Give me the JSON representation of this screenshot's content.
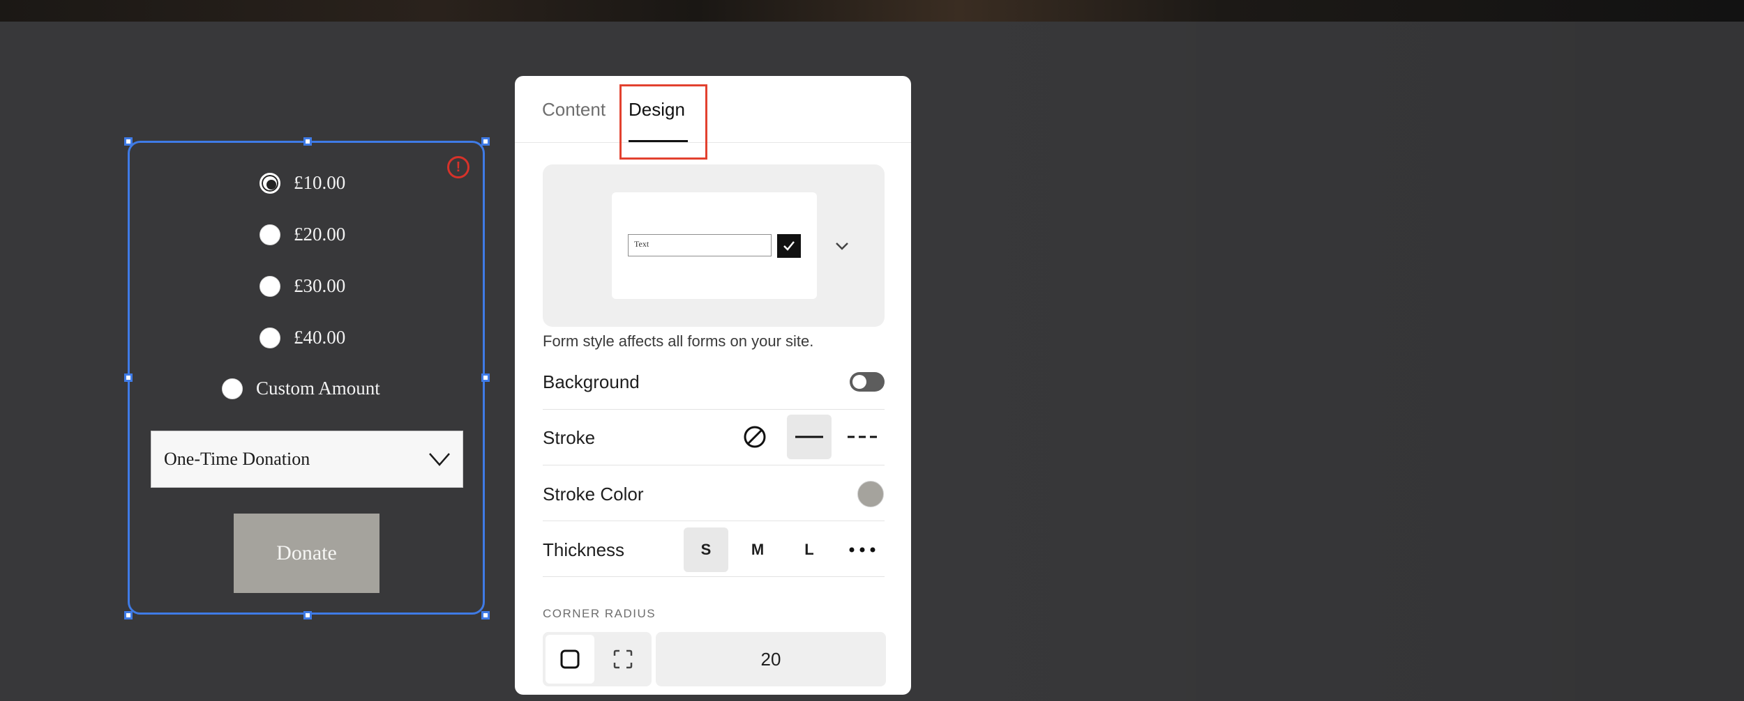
{
  "form_block": {
    "amounts": [
      {
        "label": "£10.00",
        "checked": true
      },
      {
        "label": "£20.00",
        "checked": false
      },
      {
        "label": "£30.00",
        "checked": false
      },
      {
        "label": "£40.00",
        "checked": false
      }
    ],
    "custom_amount_label": "Custom Amount",
    "frequency_select": "One-Time Donation",
    "donate_label": "Donate",
    "warning_symbol": "!"
  },
  "panel": {
    "tabs": [
      {
        "label": "Content",
        "active": false
      },
      {
        "label": "Design",
        "active": true
      }
    ],
    "preview_input_text": "Text",
    "helper_text": "Form style affects all forms on your site.",
    "background_label": "Background",
    "background_enabled": false,
    "stroke_label": "Stroke",
    "stroke_options": [
      "none-icon",
      "solid-line-icon",
      "dashed-line-icon"
    ],
    "stroke_selected": "solid-line-icon",
    "stroke_color_label": "Stroke Color",
    "stroke_color": "#a5a39d",
    "thickness_label": "Thickness",
    "thickness_options": [
      "S",
      "M",
      "L"
    ],
    "thickness_selected": "S",
    "corner_radius_heading": "CORNER RADIUS",
    "corner_radius_value": "20"
  },
  "colors": {
    "selection": "#3f7be6",
    "highlight_box": "#e2412f",
    "warning": "#d6322a",
    "button_fill": "#a5a39d"
  }
}
